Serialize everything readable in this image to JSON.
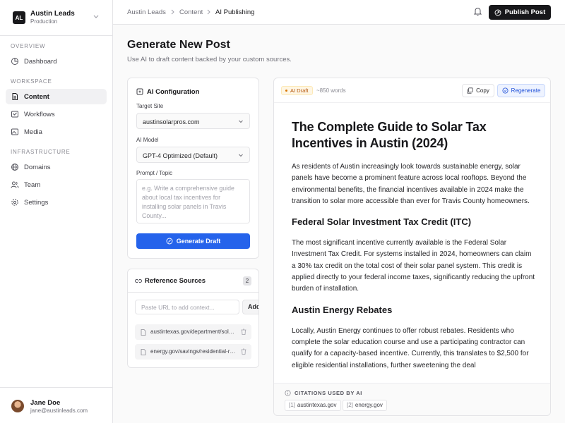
{
  "org": {
    "initials": "AL",
    "name": "Austin Leads",
    "environment": "Production"
  },
  "nav": {
    "sections": [
      {
        "title": "OVERVIEW",
        "items": [
          {
            "label": "Dashboard",
            "icon": "pie-chart-icon"
          }
        ]
      },
      {
        "title": "WORKSPACE",
        "items": [
          {
            "label": "Content",
            "icon": "file-icon",
            "active": true
          },
          {
            "label": "Workflows",
            "icon": "workflow-icon"
          },
          {
            "label": "Media",
            "icon": "image-icon"
          }
        ]
      },
      {
        "title": "INFRASTRUCTURE",
        "items": [
          {
            "label": "Domains",
            "icon": "globe-icon"
          },
          {
            "label": "Team",
            "icon": "users-icon"
          },
          {
            "label": "Settings",
            "icon": "gear-icon"
          }
        ]
      }
    ]
  },
  "user": {
    "name": "Jane Doe",
    "email": "jane@austinleads.com"
  },
  "breadcrumb": [
    "Austin Leads",
    "Content",
    "AI Publishing"
  ],
  "topbar": {
    "publish_label": "Publish Post"
  },
  "page": {
    "title": "Generate New Post",
    "subtitle": "Use AI to draft content backed by your custom sources."
  },
  "ai_config": {
    "title": "AI Configuration",
    "target_site_label": "Target Site",
    "target_site_value": "austinsolarpros.com",
    "model_label": "AI Model",
    "model_value": "GPT-4 Optimized (Default)",
    "prompt_label": "Prompt / Topic",
    "prompt_placeholder": "e.g. Write a comprehensive guide about local tax incentives for installing solar panels in Travis County...",
    "generate_label": "Generate Draft"
  },
  "references": {
    "title": "Reference Sources",
    "count": "2",
    "url_placeholder": "Paste URL to add context...",
    "add_label": "Add",
    "sources": [
      "austintexas.gov/department/solar-incentives",
      "energy.gov/savings/residential-renewable-energy-tax-credit"
    ]
  },
  "editor": {
    "badge": "AI Draft",
    "word_count": "~850 words",
    "copy_label": "Copy",
    "regenerate_label": "Regenerate",
    "title": "The Complete Guide to Solar Tax Incentives in Austin (2024)",
    "intro": "As residents of Austin increasingly look towards sustainable energy, solar panels have become a prominent feature across local rooftops. Beyond the environmental benefits, the financial incentives available in 2024 make the transition to solar more accessible than ever for Travis County homeowners.",
    "h2_federal": "Federal Solar Investment Tax Credit (ITC)",
    "p_federal": "The most significant incentive currently available is the Federal Solar Investment Tax Credit. For systems installed in 2024, homeowners can claim a 30% tax credit on the total cost of their solar panel system. This credit is applied directly to your federal income taxes, significantly reducing the upfront burden of installation.",
    "h2_austin": "Austin Energy Rebates",
    "p_austin": "Locally, Austin Energy continues to offer robust rebates. Residents who complete the solar education course and use a participating contractor can qualify for a capacity-based incentive. Currently, this translates to $2,500 for eligible residential installations, further sweetening the deal"
  },
  "citations": {
    "label": "CITATIONS USED BY AI",
    "items": [
      {
        "num": "[1]",
        "source": "austintexas.gov"
      },
      {
        "num": "[2]",
        "source": "energy.gov"
      }
    ]
  }
}
